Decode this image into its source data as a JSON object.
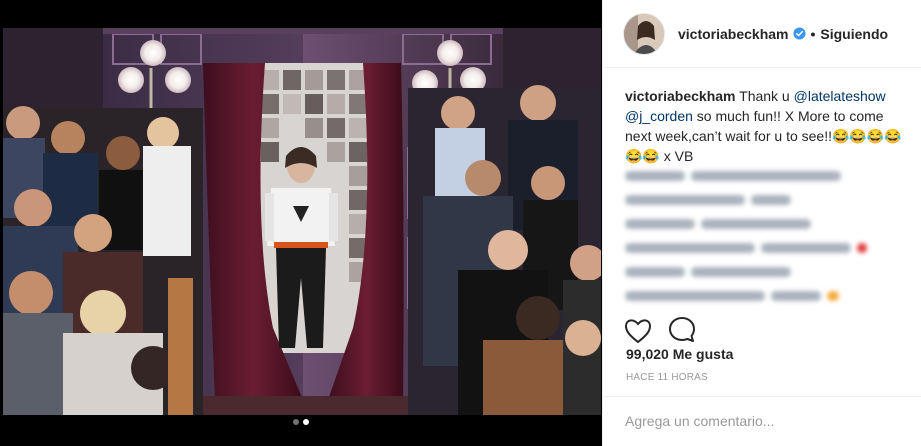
{
  "post": {
    "username": "victoriabeckham",
    "separator": "•",
    "follow_label": "Siguiendo",
    "caption": {
      "username": "victoriabeckham",
      "part1": " Thank u ",
      "mention1": "@latelateshow",
      "part2": " ",
      "mention2": "@j_corden",
      "part3": " so much fun!! X More to come next week,can’t wait for u to see!!😂😂😂😂😂😂 x VB"
    },
    "likes": "99,020 Me gusta",
    "timestamp": "HACE 11 HORAS",
    "comment_placeholder": "Agrega un comentario..."
  },
  "carousel": {
    "count": 2,
    "active_index": 1
  },
  "icons": {
    "verified": "verified-badge-icon",
    "like": "heart-icon",
    "comment": "comment-bubble-icon"
  },
  "colors": {
    "verified_blue": "#3897f0",
    "mention": "#003569",
    "text": "#262626",
    "muted": "#999999"
  }
}
